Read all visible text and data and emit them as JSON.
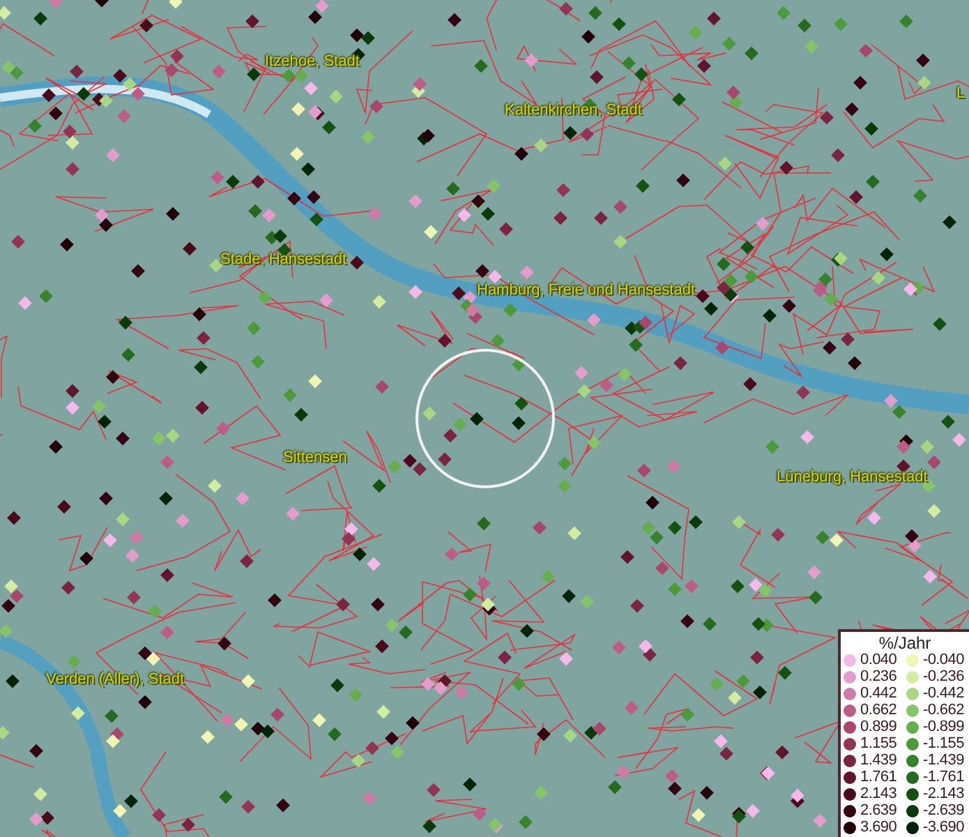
{
  "map": {
    "places": [
      {
        "name": "Itzehoe, Stadt"
      },
      {
        "name": "Kaltenkirchen, Stadt"
      },
      {
        "name": "L"
      },
      {
        "name": "Stade, Hansestadt"
      },
      {
        "name": "Hamburg, Freie und Hansestadt"
      },
      {
        "name": "Sittensen"
      },
      {
        "name": "Lüneburg, Hansestadt"
      },
      {
        "name": "Verden (Aller), Stadt"
      }
    ]
  },
  "legend": {
    "title": "%/Jahr",
    "items": [
      {
        "label": "0.040",
        "color": "#f5b8ea"
      },
      {
        "label": "-0.040",
        "color": "#f0f5b4"
      },
      {
        "label": "0.236",
        "color": "#e39ccb"
      },
      {
        "label": "-0.236",
        "color": "#d2eca2"
      },
      {
        "label": "0.442",
        "color": "#d07aa6"
      },
      {
        "label": "-0.442",
        "color": "#a8d683"
      },
      {
        "label": "0.662",
        "color": "#bd5c86"
      },
      {
        "label": "-0.662",
        "color": "#86c46a"
      },
      {
        "label": "0.899",
        "color": "#a8466b"
      },
      {
        "label": "-0.899",
        "color": "#65ad4e"
      },
      {
        "label": "1.155",
        "color": "#923555"
      },
      {
        "label": "-1.155",
        "color": "#4c9a3c"
      },
      {
        "label": "1.439",
        "color": "#7a2440"
      },
      {
        "label": "-1.439",
        "color": "#37822c"
      },
      {
        "label": "1.761",
        "color": "#62142c"
      },
      {
        "label": "-1.761",
        "color": "#256a1e"
      },
      {
        "label": "2.143",
        "color": "#4a0a1c"
      },
      {
        "label": "-2.143",
        "color": "#155212"
      },
      {
        "label": "2.639",
        "color": "#340410"
      },
      {
        "label": "-2.639",
        "color": "#0a3a0a"
      },
      {
        "label": "3.690",
        "color": "#220008"
      },
      {
        "label": "-3.690",
        "color": "#032406"
      }
    ]
  }
}
